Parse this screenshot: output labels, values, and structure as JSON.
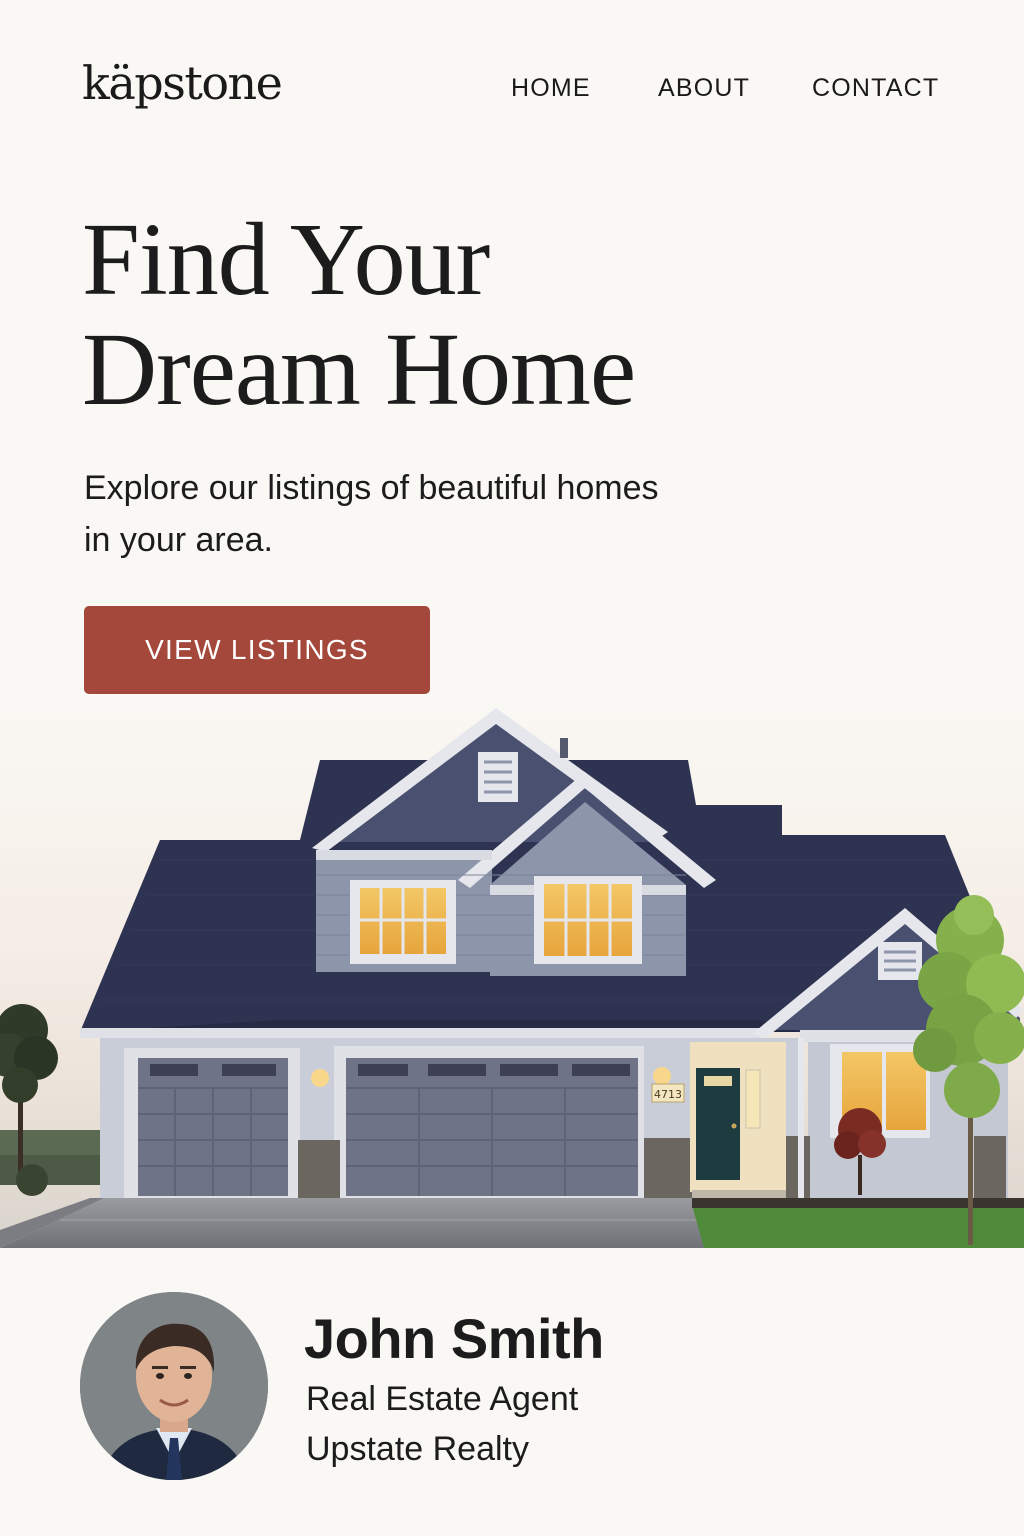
{
  "brand": {
    "logo": "käpstone"
  },
  "nav": {
    "items": [
      {
        "label": "HOME"
      },
      {
        "label": "ABOUT"
      },
      {
        "label": "CONTACT"
      }
    ]
  },
  "hero": {
    "title_line1": "Find Your",
    "title_line2": "Dream Home",
    "subtitle_line1": "Explore our listings of beautiful homes",
    "subtitle_line2": "in your area.",
    "cta_label": "VIEW LISTINGS"
  },
  "house_image": {
    "house_number": "4713"
  },
  "agent": {
    "name": "John Smith",
    "role": "Real Estate Agent",
    "company": "Upstate Realty"
  },
  "colors": {
    "background": "#faf8f4",
    "accent": "#a4483b",
    "text": "#1c1c1c",
    "roof": "#2f3352",
    "siding": "#8d95ab"
  }
}
